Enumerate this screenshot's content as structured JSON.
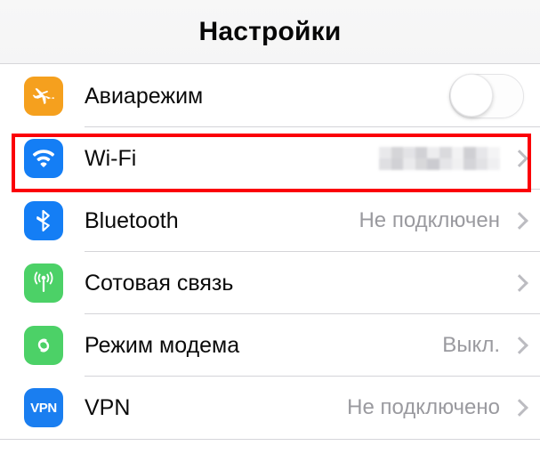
{
  "header": {
    "title": "Настройки"
  },
  "settings_list": {
    "rows": [
      {
        "id": "airplane-mode",
        "label": "Авиарежим",
        "icon": "airplane-icon",
        "icon_color": "#f5a01e",
        "accessory": "toggle",
        "toggle_state": "off",
        "value": ""
      },
      {
        "id": "wifi",
        "label": "Wi-Fi",
        "icon": "wifi-icon",
        "icon_color": "#147ef5",
        "accessory": "chevron",
        "value": "",
        "value_redacted": true,
        "highlighted": true
      },
      {
        "id": "bluetooth",
        "label": "Bluetooth",
        "icon": "bluetooth-icon",
        "icon_color": "#147ef5",
        "accessory": "chevron",
        "value": "Не подключен"
      },
      {
        "id": "cellular",
        "label": "Сотовая связь",
        "icon": "cellular-antenna-icon",
        "icon_color": "#4cd167",
        "accessory": "chevron",
        "value": ""
      },
      {
        "id": "personal-hotspot",
        "label": "Режим модема",
        "icon": "hotspot-link-icon",
        "icon_color": "#4cd167",
        "accessory": "chevron",
        "value": "Выкл."
      },
      {
        "id": "vpn",
        "label": "VPN",
        "icon": "vpn-icon",
        "icon_color": "#1a7ef0",
        "icon_text": "VPN",
        "accessory": "chevron",
        "value": "Не подключено"
      }
    ]
  },
  "annotation": {
    "highlight_color": "#fb0007",
    "target": "wifi"
  }
}
